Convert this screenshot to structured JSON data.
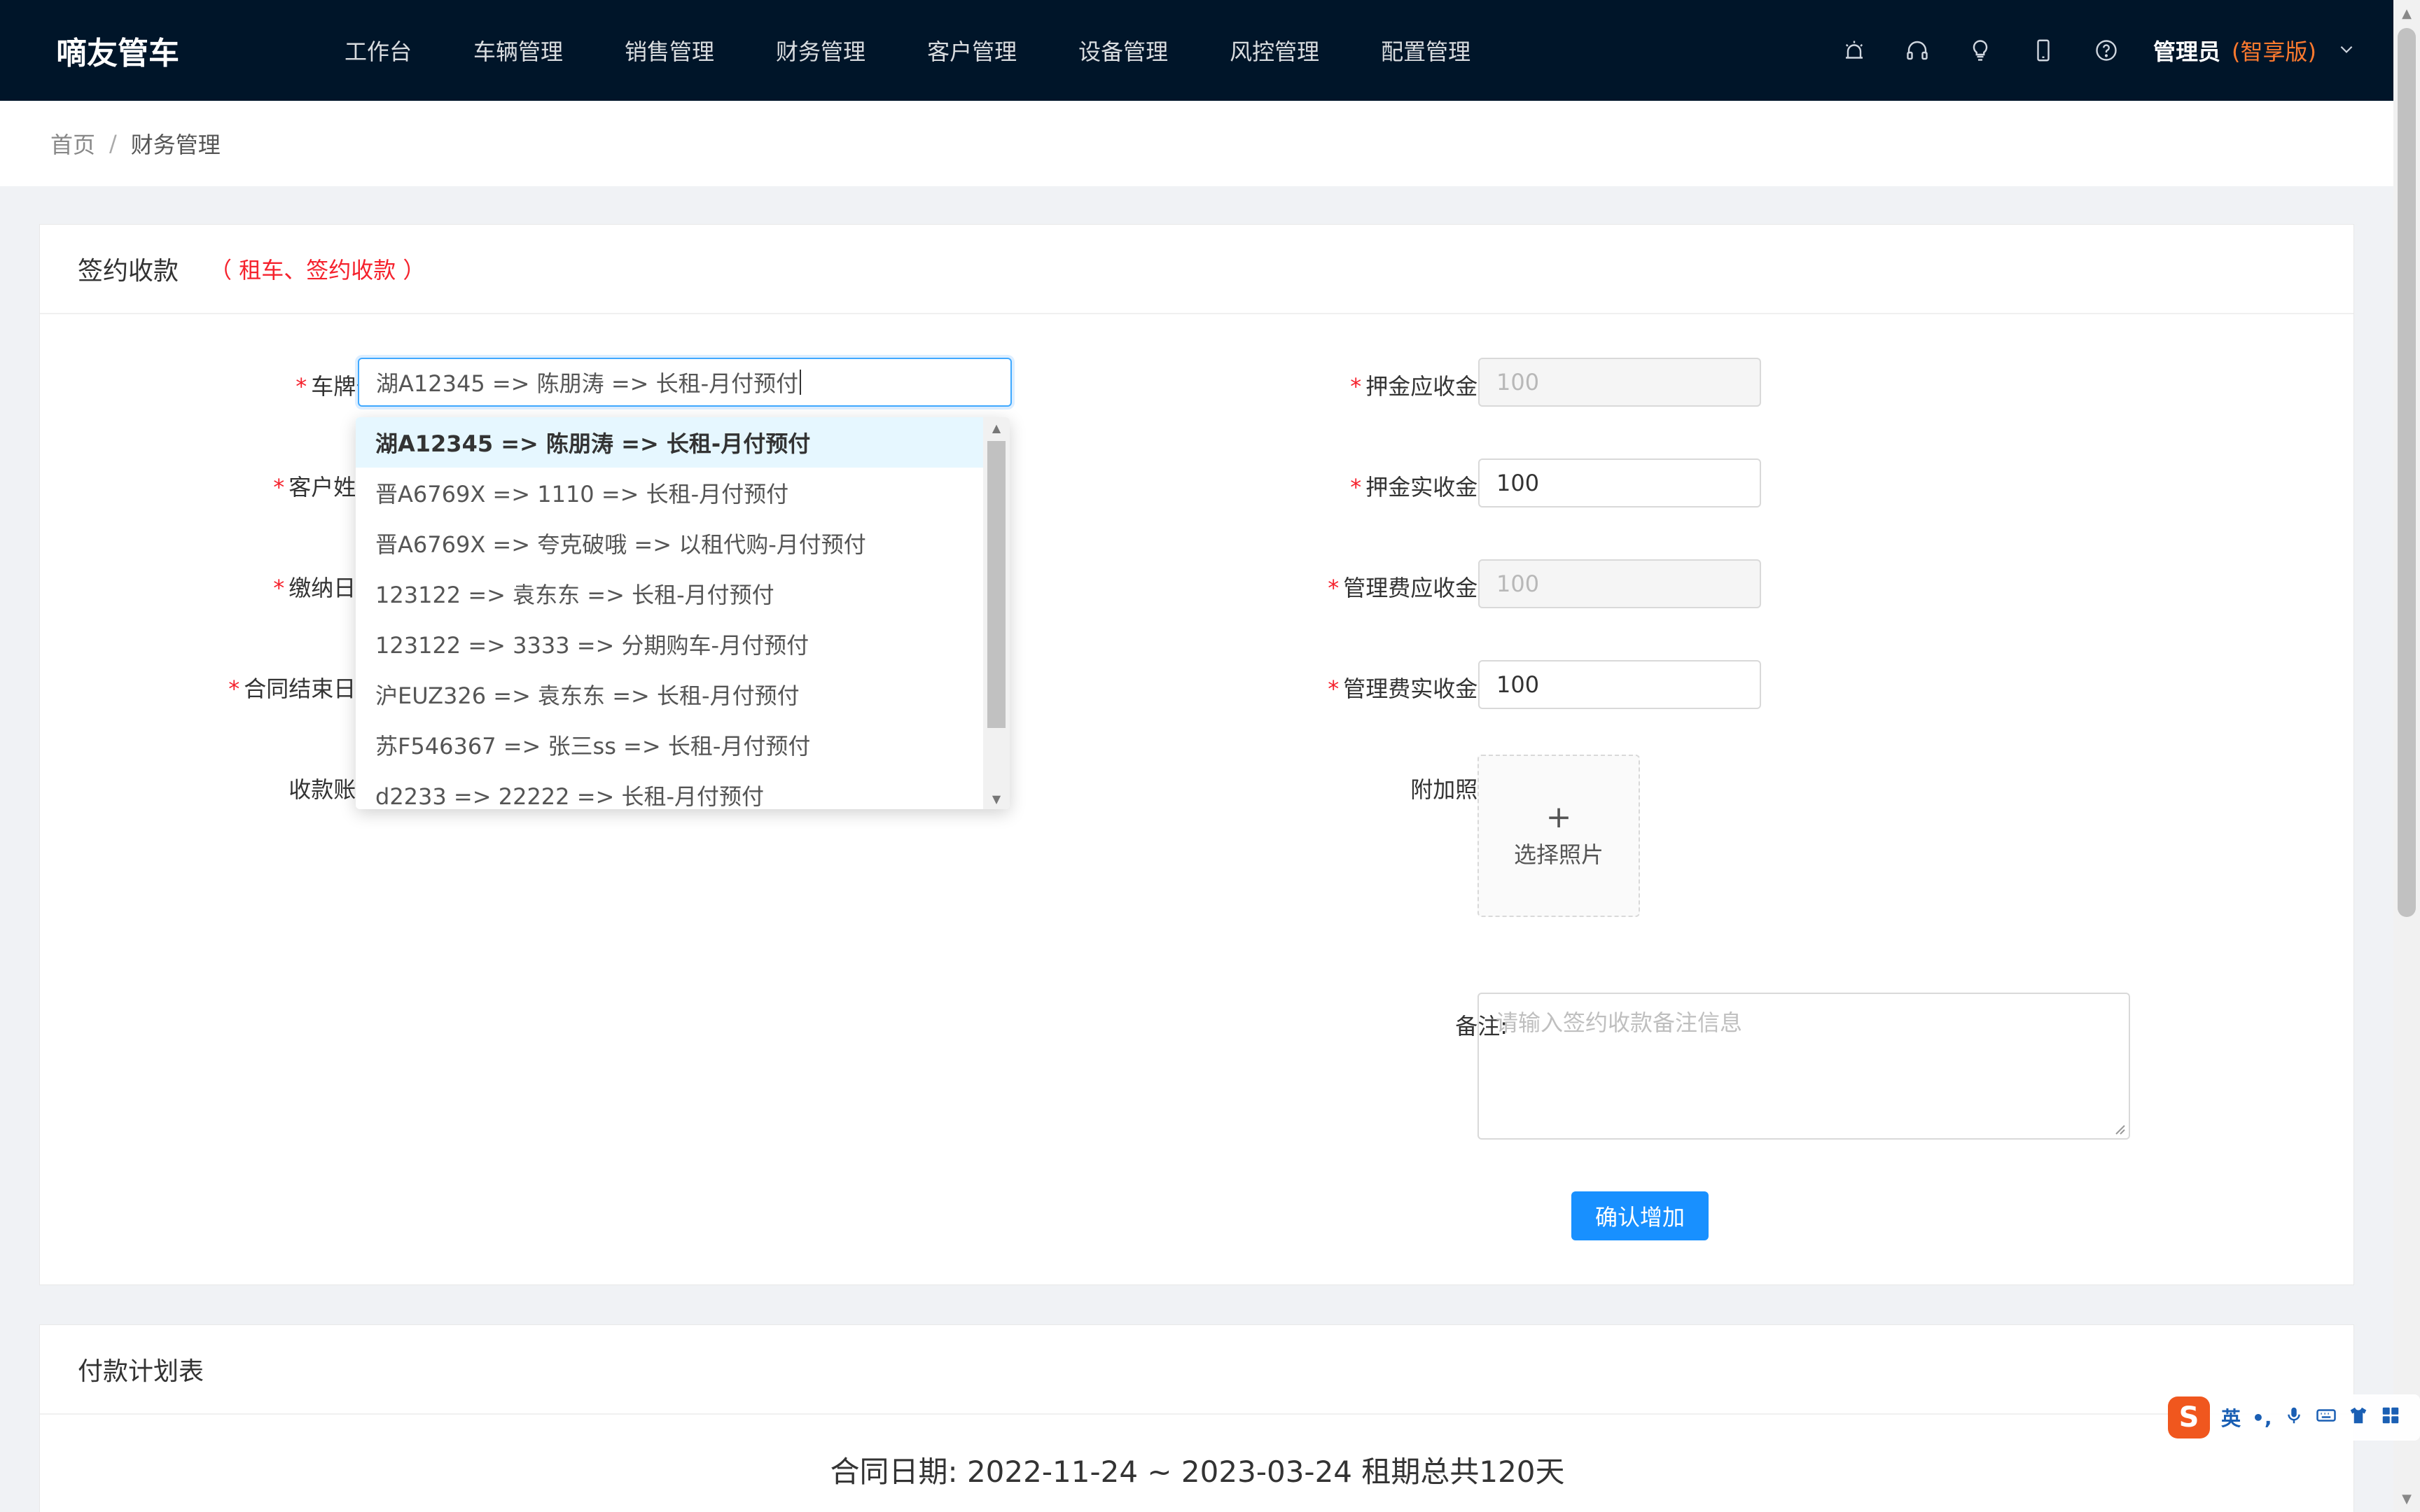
{
  "app": {
    "name": "嘀友管车"
  },
  "nav": {
    "items": [
      "工作台",
      "车辆管理",
      "销售管理",
      "财务管理",
      "客户管理",
      "设备管理",
      "风控管理",
      "配置管理"
    ],
    "icons": [
      "alarm-icon",
      "headset-icon",
      "lightbulb-icon",
      "phone-icon",
      "help-icon"
    ],
    "user": "管理员",
    "edition": "(智享版)"
  },
  "breadcrumb": {
    "home": "首页",
    "separator": "/",
    "current": "财务管理"
  },
  "form_card": {
    "title": "签约收款",
    "subtitle": "（ 租车、签约收款 ）",
    "labels": {
      "plate": "车牌号:",
      "customer": "客户姓名:",
      "pay_date": "缴纳日期:",
      "contract_end": "合同结束日期:",
      "account": "收款账户:",
      "deposit_due": "押金应收金额:",
      "deposit_paid": "押金实收金额:",
      "fee_due": "管理费应收金额:",
      "fee_paid": "管理费实收金额:",
      "photos": "附加照片:",
      "remark": "备注:"
    },
    "values": {
      "plate": "湖A12345 => 陈朋涛 => 长租-月付预付",
      "deposit_due": "100",
      "deposit_paid": "100",
      "fee_due": "100",
      "fee_paid": "100"
    },
    "upload": {
      "plus": "+",
      "label": "选择照片"
    },
    "remark_placeholder": "请输入签约收款备注信息",
    "submit": "确认增加"
  },
  "dropdown": {
    "options": [
      "湖A12345 => 陈朋涛 => 长租-月付预付",
      "晋A6769X => 1110 => 长租-月付预付",
      "晋A6769X => 夸克破哦 => 以租代购-月付预付",
      "123122 => 袁东东 => 长租-月付预付",
      "123122 => 3333 => 分期购车-月付预付",
      "沪EUZ326 => 袁东东 => 长租-月付预付",
      "苏F546367 => 张三ss => 长租-月付预付",
      "d2233 => 22222 => 长租-月付预付"
    ],
    "selected_index": 0
  },
  "plan_card": {
    "title": "付款计划表",
    "contract_line": "合同日期:  2022-11-24 ~ 2023-03-24  租期总共120天"
  },
  "ime": {
    "logo": "S",
    "lang": "英",
    "punct": "•,"
  },
  "colors": {
    "nav_bg": "#001529",
    "primary": "#1890ff",
    "required": "#f5222d",
    "edition": "#ff7a2e"
  }
}
